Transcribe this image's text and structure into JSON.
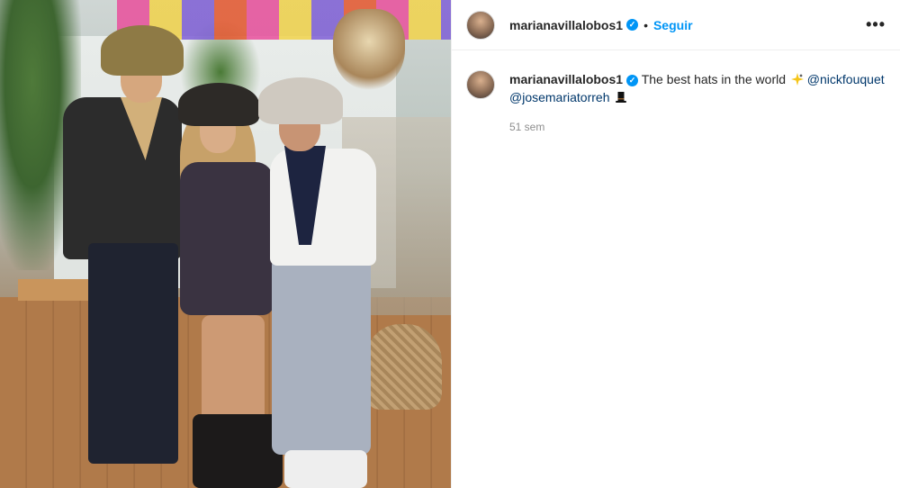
{
  "post": {
    "username": "marianavillalobos1",
    "verified_icon": "verified-badge-icon",
    "separator": "•",
    "follow_label": "Seguir",
    "more_icon": "more-options-icon",
    "more_glyph": "•••"
  },
  "caption": {
    "username": "marianavillalobos1",
    "text": "The best hats in the world",
    "emoji_1_icon": "sparkle-icon",
    "mention_1": "@nickfouquet",
    "mention_2": "@josemariatorreh",
    "emoji_2_icon": "top-hat-icon",
    "time": "51 sem"
  },
  "colors": {
    "accent": "#0095f6",
    "text": "#262626",
    "muted": "#8e8e8e",
    "mention": "#00376b"
  }
}
